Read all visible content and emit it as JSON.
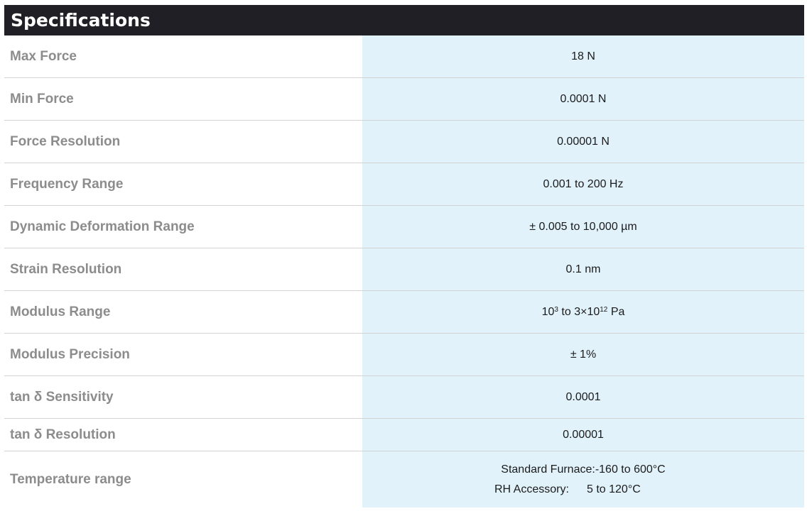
{
  "header": {
    "title": "Specifications"
  },
  "specs": [
    {
      "label": "Max Force",
      "value": "18 N"
    },
    {
      "label": "Min Force",
      "value": "0.0001 N"
    },
    {
      "label": "Force Resolution",
      "value": "0.00001 N"
    },
    {
      "label": "Frequency Range",
      "value": "0.001 to 200 Hz"
    },
    {
      "label": "Dynamic Deformation Range",
      "value": "± 0.005 to 10,000 µm"
    },
    {
      "label": "Strain Resolution",
      "value": "0.1 nm"
    },
    {
      "label": "Modulus Range",
      "value_base1": "10",
      "value_exp1": "3",
      "value_mid": " to 3×10",
      "value_exp2": "12",
      "value_unit": " Pa"
    },
    {
      "label": "Modulus Precision",
      "value": "± 1%"
    },
    {
      "label": "tan δ Sensitivity",
      "value": "0.0001"
    },
    {
      "label": "tan δ Resolution",
      "value": "0.00001"
    },
    {
      "label": "Temperature range",
      "lines": [
        {
          "name": "Standard Furnace:",
          "value": "-160 to 600°C"
        },
        {
          "name": "RH Accessory:",
          "value": "5 to 120°C"
        }
      ]
    }
  ]
}
